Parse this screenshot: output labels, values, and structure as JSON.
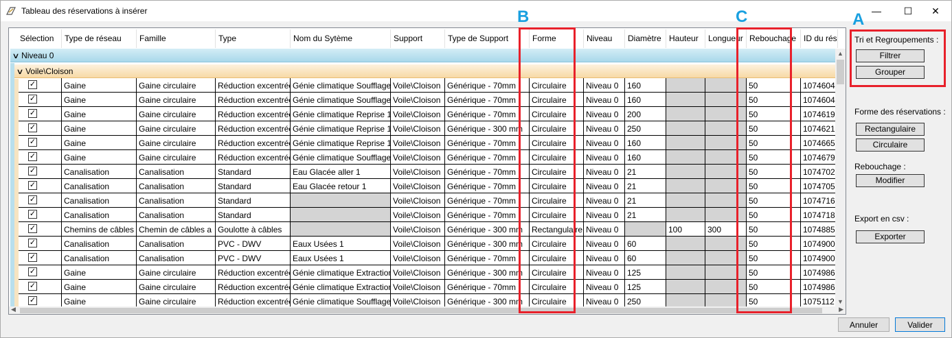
{
  "window": {
    "title": "Tableau des réservations à insérer",
    "minimize_glyph": "—",
    "maximize_glyph": "☐",
    "close_glyph": "✕"
  },
  "grid": {
    "columns": [
      "Sélection",
      "Type de réseau",
      "Famille",
      "Type",
      "Nom du Sytème",
      "Support",
      "Type de Support",
      "Forme",
      "Niveau",
      "Diamètre",
      "Hauteur",
      "Longueur",
      "Rebouchage",
      "ID du résea"
    ],
    "group_level": "Niveau 0",
    "group_support": "Voile\\Cloison",
    "rows": [
      {
        "checked": true,
        "type_reseau": "Gaine",
        "famille": "Gaine circulaire",
        "type": "Réduction excentrée",
        "nom": "Génie climatique Soufflage",
        "support": "Voile\\Cloison",
        "type_support": "Générique - 70mm",
        "forme": "Circulaire",
        "niveau": "Niveau 0",
        "diametre": "160",
        "hauteur": "",
        "longueur": "",
        "rebouchage": "50",
        "id": "1074604"
      },
      {
        "checked": true,
        "type_reseau": "Gaine",
        "famille": "Gaine circulaire",
        "type": "Réduction excentrée",
        "nom": "Génie climatique Soufflage",
        "support": "Voile\\Cloison",
        "type_support": "Générique - 70mm",
        "forme": "Circulaire",
        "niveau": "Niveau 0",
        "diametre": "160",
        "hauteur": "",
        "longueur": "",
        "rebouchage": "50",
        "id": "1074604"
      },
      {
        "checked": true,
        "type_reseau": "Gaine",
        "famille": "Gaine circulaire",
        "type": "Réduction excentrée",
        "nom": "Génie climatique Reprise 1",
        "support": "Voile\\Cloison",
        "type_support": "Générique - 70mm",
        "forme": "Circulaire",
        "niveau": "Niveau 0",
        "diametre": "200",
        "hauteur": "",
        "longueur": "",
        "rebouchage": "50",
        "id": "1074619"
      },
      {
        "checked": true,
        "type_reseau": "Gaine",
        "famille": "Gaine circulaire",
        "type": "Réduction excentrée",
        "nom": "Génie climatique Reprise 1",
        "support": "Voile\\Cloison",
        "type_support": "Générique  - 300 mm",
        "forme": "Circulaire",
        "niveau": "Niveau 0",
        "diametre": "250",
        "hauteur": "",
        "longueur": "",
        "rebouchage": "50",
        "id": "1074621"
      },
      {
        "checked": true,
        "type_reseau": "Gaine",
        "famille": "Gaine circulaire",
        "type": "Réduction excentrée",
        "nom": "Génie climatique Reprise 1",
        "support": "Voile\\Cloison",
        "type_support": "Générique - 70mm",
        "forme": "Circulaire",
        "niveau": "Niveau 0",
        "diametre": "160",
        "hauteur": "",
        "longueur": "",
        "rebouchage": "50",
        "id": "1074665"
      },
      {
        "checked": true,
        "type_reseau": "Gaine",
        "famille": "Gaine circulaire",
        "type": "Réduction excentrée",
        "nom": "Génie climatique Soufflage",
        "support": "Voile\\Cloison",
        "type_support": "Générique - 70mm",
        "forme": "Circulaire",
        "niveau": "Niveau 0",
        "diametre": "160",
        "hauteur": "",
        "longueur": "",
        "rebouchage": "50",
        "id": "1074679"
      },
      {
        "checked": true,
        "type_reseau": "Canalisation",
        "famille": "Canalisation",
        "type": "Standard",
        "nom": "Eau Glacée aller 1",
        "support": "Voile\\Cloison",
        "type_support": "Générique - 70mm",
        "forme": "Circulaire",
        "niveau": "Niveau 0",
        "diametre": "21",
        "hauteur": "",
        "longueur": "",
        "rebouchage": "50",
        "id": "1074702"
      },
      {
        "checked": true,
        "type_reseau": "Canalisation",
        "famille": "Canalisation",
        "type": "Standard",
        "nom": "Eau Glacée retour 1",
        "support": "Voile\\Cloison",
        "type_support": "Générique - 70mm",
        "forme": "Circulaire",
        "niveau": "Niveau 0",
        "diametre": "21",
        "hauteur": "",
        "longueur": "",
        "rebouchage": "50",
        "id": "1074705"
      },
      {
        "checked": true,
        "type_reseau": "Canalisation",
        "famille": "Canalisation",
        "type": "Standard",
        "nom": "",
        "support": "Voile\\Cloison",
        "type_support": "Générique - 70mm",
        "forme": "Circulaire",
        "niveau": "Niveau 0",
        "diametre": "21",
        "hauteur": "",
        "longueur": "",
        "rebouchage": "50",
        "id": "1074716"
      },
      {
        "checked": true,
        "type_reseau": "Canalisation",
        "famille": "Canalisation",
        "type": "Standard",
        "nom": "",
        "support": "Voile\\Cloison",
        "type_support": "Générique - 70mm",
        "forme": "Circulaire",
        "niveau": "Niveau 0",
        "diametre": "21",
        "hauteur": "",
        "longueur": "",
        "rebouchage": "50",
        "id": "1074718"
      },
      {
        "checked": true,
        "type_reseau": "Chemins de câbles",
        "famille": "Chemin de câbles a",
        "type": "Goulotte à câbles",
        "nom": "",
        "support": "Voile\\Cloison",
        "type_support": "Générique  - 300 mm",
        "forme": "Rectangulaire",
        "niveau": "Niveau 0",
        "diametre": "",
        "hauteur": "100",
        "longueur": "300",
        "rebouchage": "50",
        "id": "1074885"
      },
      {
        "checked": true,
        "type_reseau": "Canalisation",
        "famille": "Canalisation",
        "type": "PVC - DWV",
        "nom": "Eaux Usées 1",
        "support": "Voile\\Cloison",
        "type_support": "Générique  - 300 mm",
        "forme": "Circulaire",
        "niveau": "Niveau 0",
        "diametre": "60",
        "hauteur": "",
        "longueur": "",
        "rebouchage": "50",
        "id": "1074900"
      },
      {
        "checked": true,
        "type_reseau": "Canalisation",
        "famille": "Canalisation",
        "type": "PVC - DWV",
        "nom": "Eaux Usées 1",
        "support": "Voile\\Cloison",
        "type_support": "Générique - 70mm",
        "forme": "Circulaire",
        "niveau": "Niveau 0",
        "diametre": "60",
        "hauteur": "",
        "longueur": "",
        "rebouchage": "50",
        "id": "1074900"
      },
      {
        "checked": true,
        "type_reseau": "Gaine",
        "famille": "Gaine circulaire",
        "type": "Réduction excentrée",
        "nom": "Génie climatique Extraction",
        "support": "Voile\\Cloison",
        "type_support": "Générique  - 300 mm",
        "forme": "Circulaire",
        "niveau": "Niveau 0",
        "diametre": "125",
        "hauteur": "",
        "longueur": "",
        "rebouchage": "50",
        "id": "1074986"
      },
      {
        "checked": true,
        "type_reseau": "Gaine",
        "famille": "Gaine circulaire",
        "type": "Réduction excentrée",
        "nom": "Génie climatique Extraction",
        "support": "Voile\\Cloison",
        "type_support": "Générique - 70mm",
        "forme": "Circulaire",
        "niveau": "Niveau 0",
        "diametre": "125",
        "hauteur": "",
        "longueur": "",
        "rebouchage": "50",
        "id": "1074986"
      },
      {
        "checked": true,
        "type_reseau": "Gaine",
        "famille": "Gaine circulaire",
        "type": "Réduction excentrée",
        "nom": "Génie climatique Soufflage",
        "support": "Voile\\Cloison",
        "type_support": "Générique  - 300 mm",
        "forme": "Circulaire",
        "niveau": "Niveau 0",
        "diametre": "250",
        "hauteur": "",
        "longueur": "",
        "rebouchage": "50",
        "id": "1075112"
      }
    ]
  },
  "side": {
    "tri_label": "Tri et Regroupements :",
    "filtrer": "Filtrer",
    "grouper": "Grouper",
    "forme_label": "Forme des réservations :",
    "rectangulaire": "Rectangulaire",
    "circulaire": "Circulaire",
    "rebouchage_label": "Rebouchage :",
    "modifier": "Modifier",
    "export_label": "Export en csv :",
    "exporter": "Exporter"
  },
  "footer": {
    "annuler": "Annuler",
    "valider": "Valider"
  },
  "annotations": {
    "a": "A",
    "b": "B",
    "c": "C",
    "color": "#e8202a",
    "letter_color": "#19a0e0"
  },
  "check_glyph": "✓",
  "chevron_glyph": "∨"
}
